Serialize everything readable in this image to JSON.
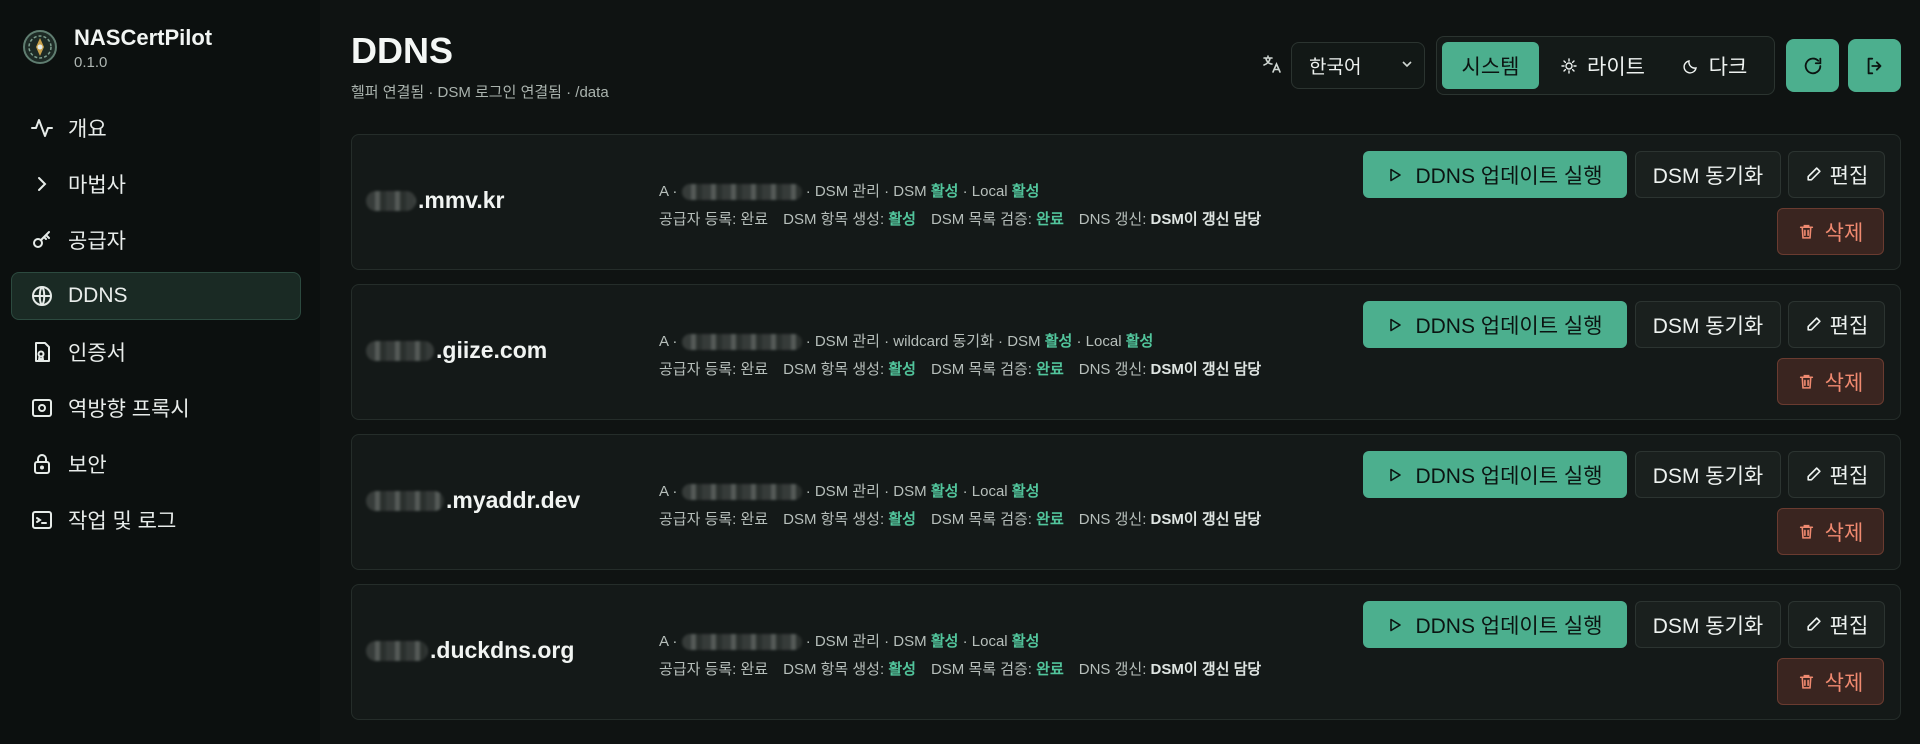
{
  "app": {
    "name": "NASCertPilot",
    "version": "0.1.0"
  },
  "nav": [
    {
      "label": "개요",
      "icon": "activity-icon"
    },
    {
      "label": "마법사",
      "icon": "chevron-right-icon"
    },
    {
      "label": "공급자",
      "icon": "key-icon"
    },
    {
      "label": "DDNS",
      "icon": "globe-icon",
      "active": true
    },
    {
      "label": "인증서",
      "icon": "certificate-icon"
    },
    {
      "label": "역방향 프록시",
      "icon": "proxy-icon"
    },
    {
      "label": "보안",
      "icon": "lock-icon"
    },
    {
      "label": "작업 및 로그",
      "icon": "terminal-icon"
    }
  ],
  "header": {
    "title": "DDNS",
    "subtitle": "헬퍼 연결됨 · DSM 로그인 연결됨 · /data",
    "language": "한국어",
    "themes": [
      "시스템",
      "라이트",
      "다크"
    ],
    "active_theme": "시스템"
  },
  "labels": {
    "run": "DDNS 업데이트 실행",
    "sync": "DSM 동기화",
    "edit": "편집",
    "delete": "삭제",
    "record_type": "A ·",
    "dsm_managed": "· DSM 관리 ·",
    "dsm_managed_wildcard": "· DSM 관리 · wildcard 동기화 ·",
    "dsm": "DSM",
    "local": "· Local",
    "active": "활성",
    "provider_reg": "공급자 등록: 완료",
    "dsm_entry": "DSM 항목 생성:",
    "dsm_verify": "DSM 목록 검증:",
    "complete": "완료",
    "dns_refresh": "DNS 갱신:",
    "dns_owner": "DSM이 갱신 담당"
  },
  "records": [
    {
      "domain": ".mmv.kr",
      "wildcard": false
    },
    {
      "domain": ".giize.com",
      "wildcard": true
    },
    {
      "domain": ".myaddr.dev",
      "wildcard": false
    },
    {
      "domain": ".duckdns.org",
      "wildcard": false
    }
  ],
  "colors": {
    "accent": "#4caf8e",
    "ok": "#52c59c",
    "danger": "#f08a70"
  }
}
